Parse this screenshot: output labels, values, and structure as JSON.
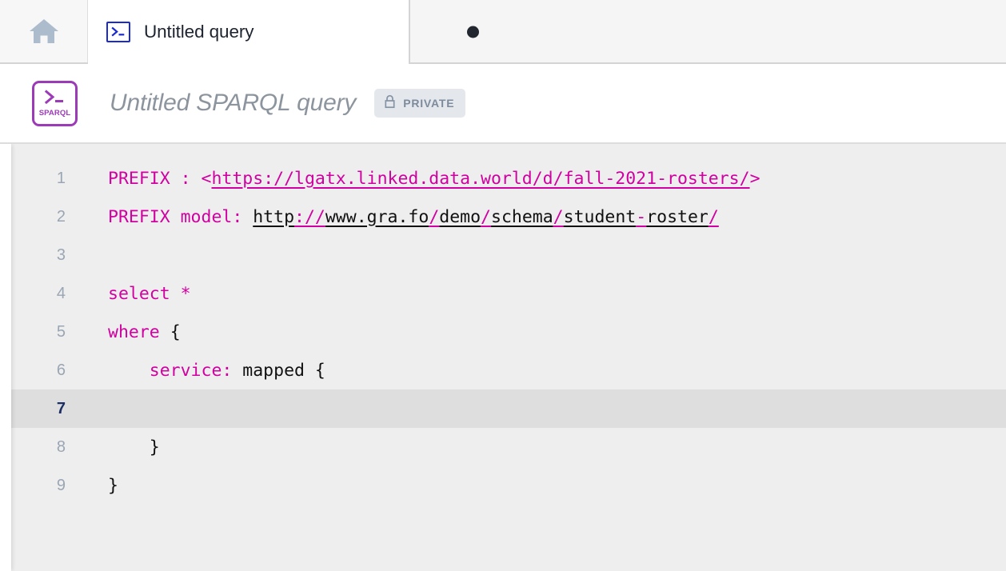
{
  "window": {
    "bg": "#ffffff"
  },
  "tabbar": {
    "home_icon": "home-icon",
    "tabs": [
      {
        "icon": "terminal-prompt-icon",
        "label": "Untitled query",
        "dirty_indicator": "unsaved-dot",
        "active": true
      }
    ]
  },
  "document_header": {
    "badge": {
      "icon": "terminal-prompt-icon",
      "label": "SPARQL",
      "color": "#9c3bb8"
    },
    "title": "Untitled SPARQL query",
    "visibility_badge": {
      "icon": "lock-icon",
      "label": "PRIVATE"
    }
  },
  "editor": {
    "language": "sparql",
    "active_line": 7,
    "colors": {
      "background": "#eeeeee",
      "active_line_background": "#dedede",
      "keyword": "#d100a0",
      "plain": "#101010",
      "gutter": "#9aa6b4",
      "gutter_active": "#1b2f66"
    },
    "lines": [
      {
        "n": "1",
        "text": "PREFIX : <https://lgatx.linked.data.world/d/fall-2021-rosters/>"
      },
      {
        "n": "2",
        "text": "PREFIX model: http://www.gra.fo/demo/schema/student-roster/"
      },
      {
        "n": "3",
        "text": ""
      },
      {
        "n": "4",
        "text": "select *"
      },
      {
        "n": "5",
        "text": "where {"
      },
      {
        "n": "6",
        "text": "    service: mapped {"
      },
      {
        "n": "7",
        "text": ""
      },
      {
        "n": "8",
        "text": "    }"
      },
      {
        "n": "9",
        "text": "}"
      }
    ]
  }
}
